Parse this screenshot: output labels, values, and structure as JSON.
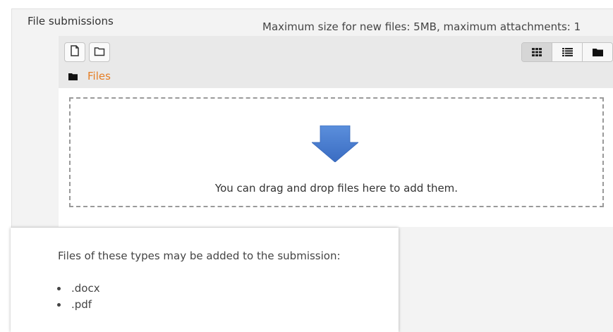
{
  "field": {
    "label": "File submissions",
    "max_size_text": "Maximum size for new files: 5MB, maximum attachments: 1"
  },
  "toolbar": {
    "add_file_icon": "file-icon",
    "create_folder_icon": "folder-outline-icon",
    "views": [
      {
        "icon": "grid-icon",
        "label": "Display folder with file icons",
        "active": true
      },
      {
        "icon": "list-icon",
        "label": "Display folder with file details",
        "active": false
      },
      {
        "icon": "folder-tree-icon",
        "label": "Display folder as file tree",
        "active": false
      }
    ]
  },
  "path": {
    "icon": "folder-icon",
    "label": "Files"
  },
  "dropzone": {
    "icon": "down-arrow-icon",
    "text": "You can drag and drop files here to add them."
  },
  "accepted_types": {
    "title": "Files of these types may be added to the submission:",
    "types": [
      ".docx",
      ".pdf"
    ]
  },
  "colors": {
    "accent": "#e57e25",
    "arrow": "#4a7fd0",
    "panel_bg": "#f3f3f3"
  }
}
